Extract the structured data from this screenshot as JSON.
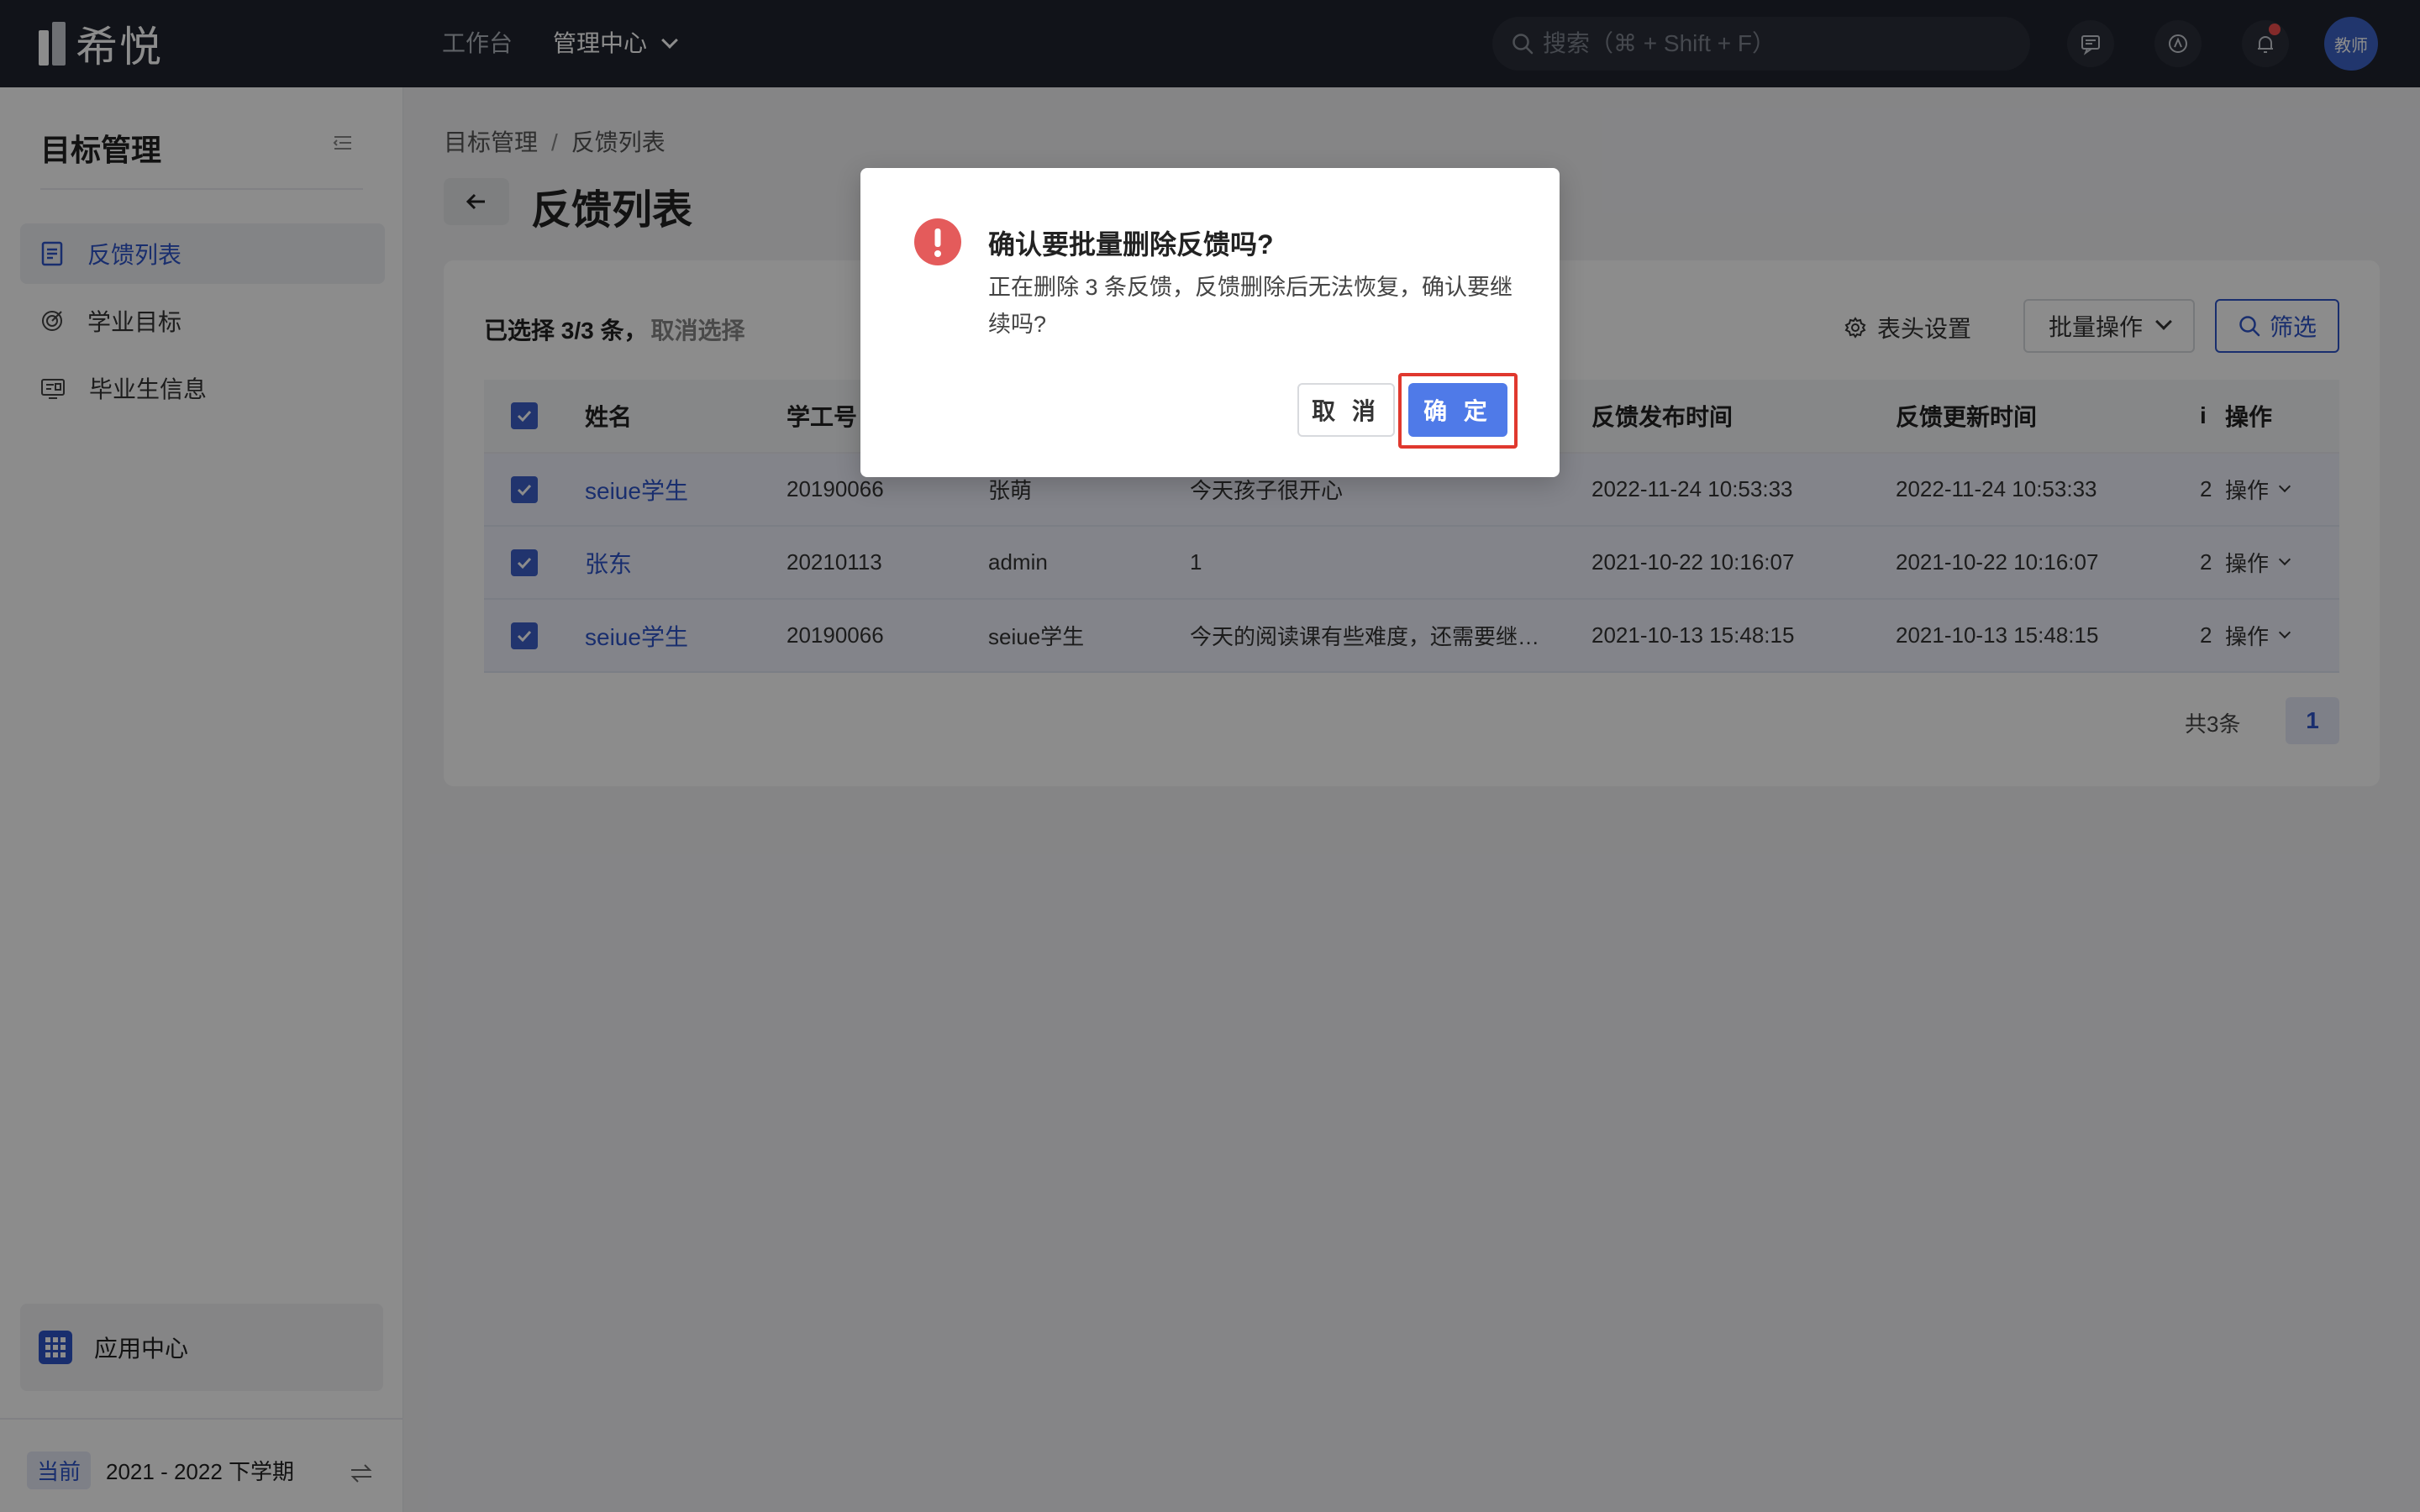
{
  "topbar": {
    "logo_text": "希悦",
    "nav": [
      {
        "label": "工作台"
      },
      {
        "label": "管理中心"
      }
    ],
    "search_placeholder": "搜索（⌘ + Shift + F）",
    "avatar_text": "教师"
  },
  "sidebar": {
    "title": "目标管理",
    "items": [
      {
        "label": "反馈列表",
        "icon": "document-list-icon"
      },
      {
        "label": "学业目标",
        "icon": "target-icon"
      },
      {
        "label": "毕业生信息",
        "icon": "id-card-icon"
      }
    ],
    "app_center": "应用中心",
    "term_tag": "当前",
    "term_label": "2021 - 2022 下学期"
  },
  "main": {
    "breadcrumb": [
      "目标管理",
      "反馈列表"
    ],
    "breadcrumb_sep": "/",
    "title": "反馈列表",
    "selection_text": "已选择 3/3 条，",
    "cancel_selection": "取消选择",
    "header_settings": "表头设置",
    "batch_ops": "批量操作",
    "filter": "筛选",
    "table": {
      "columns": [
        "姓名",
        "学工号",
        "",
        "",
        "反馈发布时间",
        "反馈更新时间",
        "i",
        "操作"
      ],
      "rows": [
        {
          "name": "seiue学生",
          "id": "20190066",
          "author": "张萌",
          "content": "今天孩子很开心",
          "published": "2022-11-24 10:53:33",
          "updated": "2022-11-24 10:53:33",
          "x": "2",
          "op": "操作"
        },
        {
          "name": "张东",
          "id": "20210113",
          "author": "admin",
          "content": "1",
          "published": "2021-10-22 10:16:07",
          "updated": "2021-10-22 10:16:07",
          "x": "2",
          "op": "操作"
        },
        {
          "name": "seiue学生",
          "id": "20190066",
          "author": "seiue学生",
          "content": "今天的阅读课有些难度，还需要继…",
          "published": "2021-10-13 15:48:15",
          "updated": "2021-10-13 15:48:15",
          "x": "2",
          "op": "操作"
        }
      ]
    },
    "pager_total": "共3条",
    "pager_page": "1"
  },
  "modal": {
    "title": "确认要批量删除反馈吗?",
    "body": "正在删除 3 条反馈，反馈删除后无法恢复，确认要继续吗?",
    "cancel": "取 消",
    "ok": "确 定"
  },
  "colors": {
    "accent": "#2f54c9",
    "danger": "#e45b5b",
    "highlight_frame": "#e0382e"
  }
}
